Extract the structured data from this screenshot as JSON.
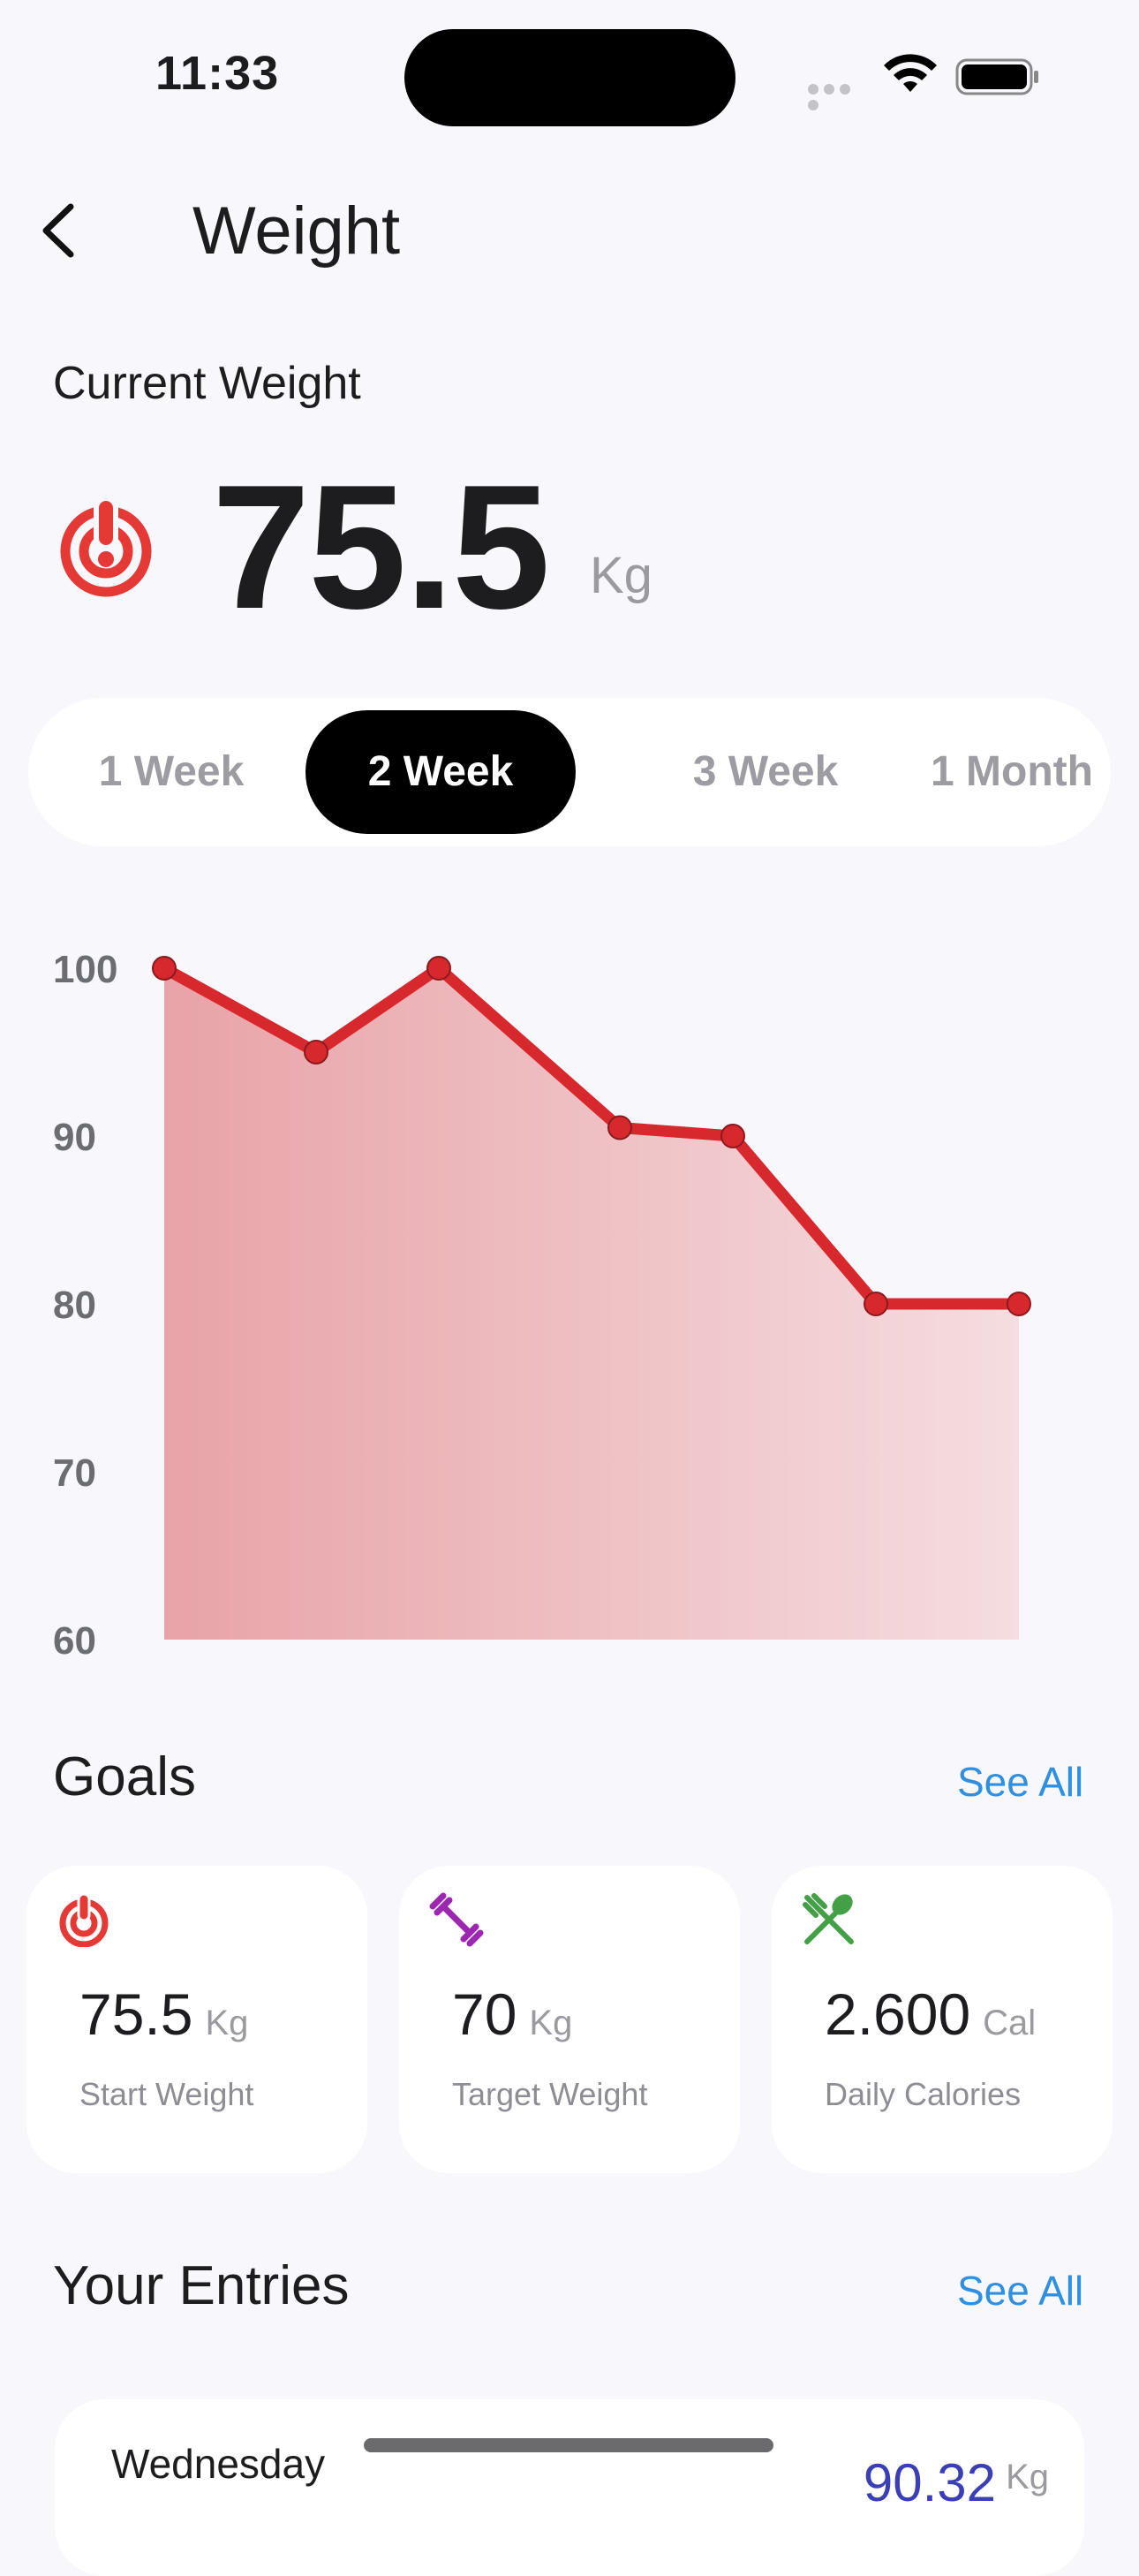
{
  "status": {
    "time": "11:33"
  },
  "header": {
    "title": "Weight"
  },
  "current": {
    "label": "Current Weight",
    "value": "75.5",
    "unit": "Kg"
  },
  "tabs": [
    {
      "label": "1 Week",
      "active": false
    },
    {
      "label": "2 Week",
      "active": true
    },
    {
      "label": "3 Week",
      "active": false
    },
    {
      "label": "1 Month",
      "active": false
    }
  ],
  "chart_data": {
    "type": "area",
    "x_count": 7,
    "values": [
      100,
      95,
      100,
      90.5,
      90,
      80,
      80
    ],
    "ylim": [
      60,
      100
    ],
    "yticks": [
      "100",
      "90",
      "80",
      "70",
      "60"
    ],
    "color": "#d7282e",
    "grid": false
  },
  "goals": {
    "title": "Goals",
    "see_all": "See All",
    "cards": [
      {
        "value": "75.5",
        "unit": "Kg",
        "label": "Start Weight",
        "icon": "target-icon",
        "color": "#e53935"
      },
      {
        "value": "70",
        "unit": "Kg",
        "label": "Target Weight",
        "icon": "dumbbell-icon",
        "color": "#9c27b0"
      },
      {
        "value": "2.600",
        "unit": "Cal",
        "label": "Daily Calories",
        "icon": "fork-spoon-icon",
        "color": "#43a047"
      }
    ]
  },
  "entries": {
    "title": "Your Entries",
    "see_all": "See All",
    "items": [
      {
        "day": "Wednesday",
        "value": "90.32",
        "unit": "Kg"
      }
    ]
  }
}
